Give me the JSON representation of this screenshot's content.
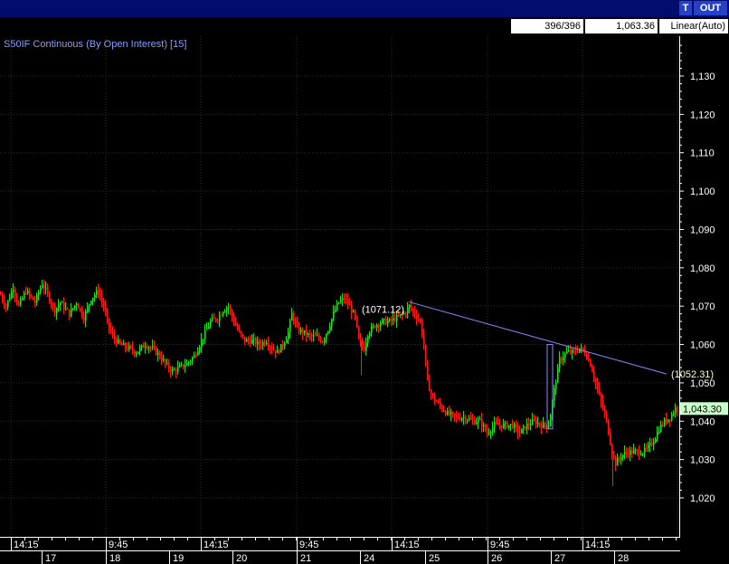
{
  "colors": {
    "up": "#22dd22",
    "down": "#ff1a1a",
    "grid": "#2e2e2e",
    "trendline": "#8a8aff",
    "title": "#8a9cff",
    "text": "#ffffff",
    "highlight": "#8a8aff",
    "titlebar": "#000c6e",
    "button": "#2640c8",
    "last_label_bg": "#c8ffc8"
  },
  "toolbar": {
    "t_label": "T",
    "out_label": "OUT"
  },
  "status": {
    "bars": "396/396",
    "value": "1,063.36",
    "scale": "Linear(Auto)"
  },
  "chart_data": {
    "type": "candlestick",
    "title": "S50IF Continuous (By Open Interest) [15]",
    "y_ticks": [
      "1,020",
      "1,030",
      "1,040",
      "1,050",
      "1,060",
      "1,070",
      "1,080",
      "1,090",
      "1,100",
      "1,110",
      "1,120",
      "1,130"
    ],
    "ylim": [
      1016,
      1137
    ],
    "time_labels": [
      "14:15",
      "9:45",
      "14:15",
      "9:45",
      "14:15",
      "9:45",
      "14:15"
    ],
    "date_labels": [
      "17",
      "18",
      "19",
      "20",
      "21",
      "24",
      "25",
      "26",
      "27",
      "28"
    ],
    "annotations": [
      {
        "text": "(1071.12)",
        "value": 1071.12
      },
      {
        "text": "(1052.31)",
        "value": 1052.31
      }
    ],
    "trendline": {
      "start": 1071.12,
      "end": 1052.31
    },
    "last_price": {
      "text": "1,043.30",
      "value": 1043.3
    },
    "price_path": [
      [
        0,
        1073
      ],
      [
        6,
        1070
      ],
      [
        14,
        1075
      ],
      [
        20,
        1070
      ],
      [
        28,
        1074
      ],
      [
        38,
        1071
      ],
      [
        46,
        1076
      ],
      [
        54,
        1072
      ],
      [
        60,
        1069
      ],
      [
        66,
        1071
      ],
      [
        76,
        1068
      ],
      [
        84,
        1071
      ],
      [
        92,
        1067
      ],
      [
        100,
        1072
      ],
      [
        108,
        1074
      ],
      [
        114,
        1070
      ],
      [
        118,
        1066
      ],
      [
        124,
        1062
      ],
      [
        132,
        1060
      ],
      [
        142,
        1059
      ],
      [
        150,
        1058
      ],
      [
        160,
        1060
      ],
      [
        168,
        1059
      ],
      [
        176,
        1057
      ],
      [
        182,
        1055
      ],
      [
        190,
        1053
      ],
      [
        198,
        1054
      ],
      [
        206,
        1055
      ],
      [
        214,
        1057
      ],
      [
        220,
        1060
      ],
      [
        226,
        1063
      ],
      [
        232,
        1066
      ],
      [
        240,
        1067
      ],
      [
        246,
        1069
      ],
      [
        252,
        1070
      ],
      [
        258,
        1066
      ],
      [
        264,
        1063
      ],
      [
        270,
        1061
      ],
      [
        278,
        1061
      ],
      [
        286,
        1060
      ],
      [
        294,
        1061
      ],
      [
        300,
        1059
      ],
      [
        306,
        1058
      ],
      [
        312,
        1060
      ],
      [
        318,
        1063
      ],
      [
        322,
        1068
      ],
      [
        328,
        1064
      ],
      [
        336,
        1063
      ],
      [
        344,
        1062
      ],
      [
        350,
        1062
      ],
      [
        356,
        1061
      ],
      [
        362,
        1064
      ],
      [
        368,
        1068
      ],
      [
        374,
        1071
      ],
      [
        380,
        1072
      ],
      [
        386,
        1070
      ],
      [
        392,
        1067
      ],
      [
        396,
        1061
      ],
      [
        402,
        1059
      ],
      [
        406,
        1063
      ],
      [
        414,
        1065
      ],
      [
        422,
        1066
      ],
      [
        430,
        1066
      ],
      [
        438,
        1067
      ],
      [
        446,
        1068
      ],
      [
        452,
        1070
      ],
      [
        458,
        1068
      ],
      [
        464,
        1066
      ],
      [
        468,
        1060
      ],
      [
        472,
        1050
      ],
      [
        478,
        1046
      ],
      [
        486,
        1044
      ],
      [
        494,
        1042
      ],
      [
        504,
        1041
      ],
      [
        514,
        1041
      ],
      [
        522,
        1040
      ],
      [
        530,
        1040
      ],
      [
        538,
        1037
      ],
      [
        546,
        1039
      ],
      [
        556,
        1039
      ],
      [
        566,
        1039
      ],
      [
        574,
        1037
      ],
      [
        582,
        1039
      ],
      [
        590,
        1040
      ],
      [
        598,
        1039
      ],
      [
        606,
        1039
      ],
      [
        612,
        1048
      ],
      [
        618,
        1056
      ],
      [
        626,
        1058
      ],
      [
        634,
        1058
      ],
      [
        640,
        1059
      ],
      [
        646,
        1058
      ],
      [
        652,
        1055
      ],
      [
        658,
        1050
      ],
      [
        664,
        1045
      ],
      [
        670,
        1040
      ],
      [
        676,
        1032
      ],
      [
        680,
        1029
      ],
      [
        686,
        1031
      ],
      [
        694,
        1032
      ],
      [
        702,
        1032
      ],
      [
        710,
        1032
      ],
      [
        716,
        1033
      ],
      [
        722,
        1035
      ],
      [
        728,
        1038
      ],
      [
        734,
        1040
      ],
      [
        740,
        1041
      ],
      [
        746,
        1043.3
      ]
    ]
  }
}
